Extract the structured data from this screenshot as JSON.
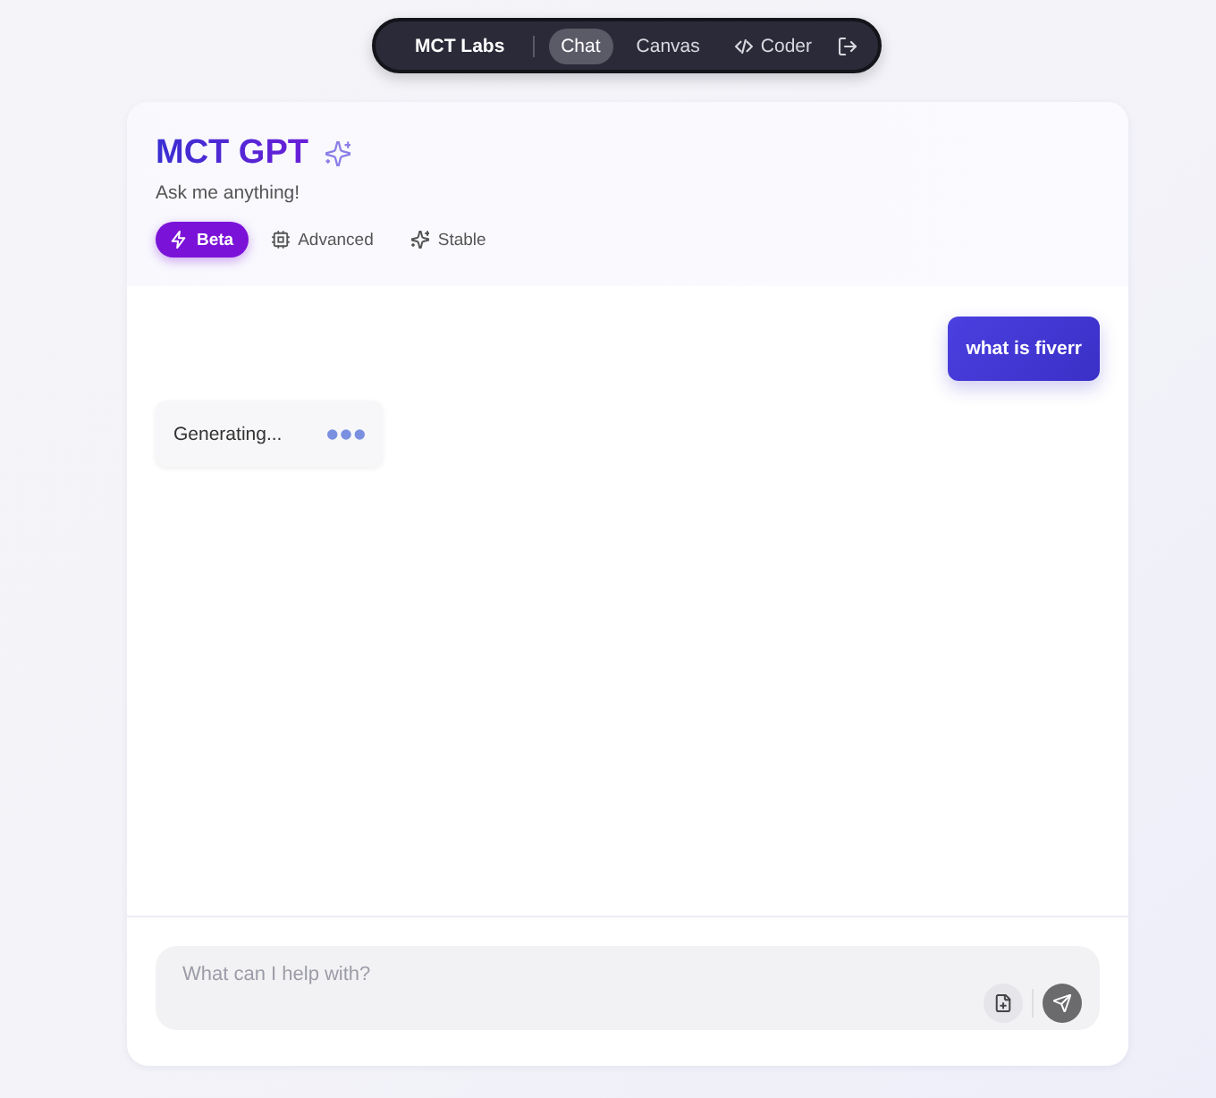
{
  "nav": {
    "brand": "MCT Labs",
    "items": [
      {
        "label": "Chat",
        "selected": true,
        "kind": "text"
      },
      {
        "label": "Canvas",
        "selected": false,
        "kind": "text"
      },
      {
        "label": "Coder",
        "selected": false,
        "kind": "code"
      }
    ]
  },
  "header": {
    "title": "MCT GPT",
    "subtitle": "Ask me anything!",
    "modes": [
      {
        "label": "Beta",
        "selected": true,
        "kind": "bolt"
      },
      {
        "label": "Advanced",
        "selected": false,
        "kind": "chip"
      },
      {
        "label": "Stable",
        "selected": false,
        "kind": "sparkle"
      }
    ]
  },
  "messages": [
    {
      "kind": "user",
      "text": "what is fiverr"
    },
    {
      "kind": "assistant",
      "text": "Generating...",
      "loading": true
    }
  ],
  "composer": {
    "placeholder": "What can I help with?"
  }
}
